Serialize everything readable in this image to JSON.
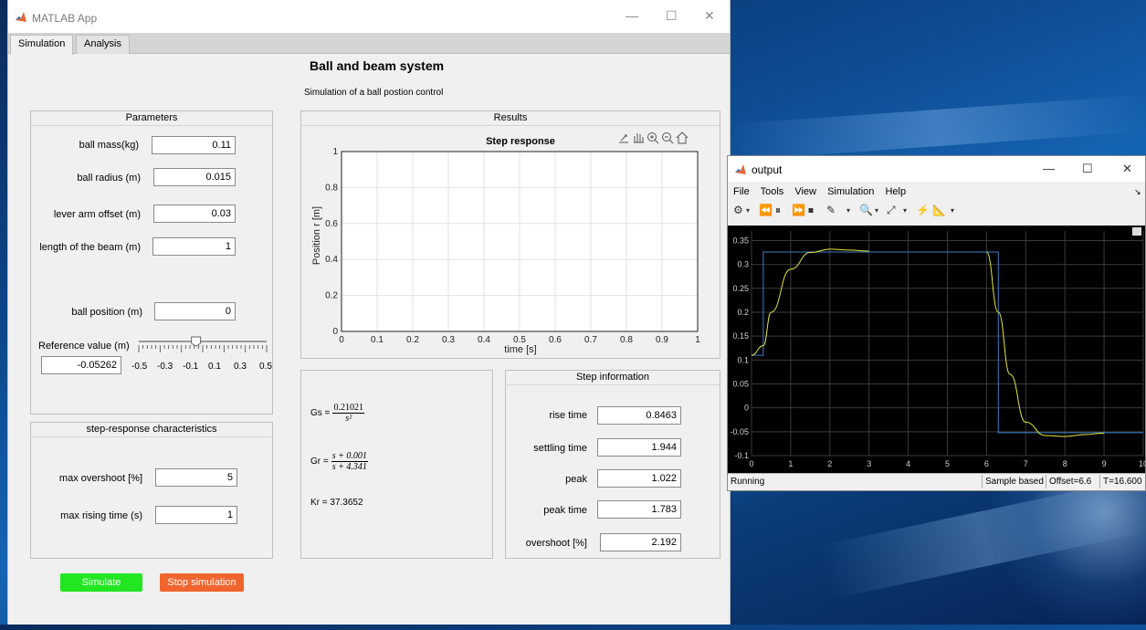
{
  "app": {
    "title": "MATLAB App",
    "tabs": [
      "Simulation",
      "Analysis"
    ],
    "heading": "Ball and beam system",
    "subheading": "Simulation of a ball postion control"
  },
  "parameters": {
    "title": "Parameters",
    "fields": [
      {
        "label": "ball mass(kg)",
        "value": "0.11"
      },
      {
        "label": "ball radius (m)",
        "value": "0.015"
      },
      {
        "label": "lever arm offset (m)",
        "value": "0.03"
      },
      {
        "label": "length of the beam (m)",
        "value": "1"
      },
      {
        "label": "ball position (m)",
        "value": "0"
      }
    ],
    "reference_label": "Reference value (m)",
    "reference_value": "-0.05262",
    "slider_ticks": [
      "-0.5",
      "-0.3",
      "-0.1",
      "0.1",
      "0.3",
      "0.5"
    ],
    "slider_value": -0.05262
  },
  "results": {
    "title": "Results",
    "plot_title": "Step response",
    "xlabel": "time [s]",
    "ylabel": "Position  r [m]",
    "xticks": [
      "0",
      "0.1",
      "0.2",
      "0.3",
      "0.4",
      "0.5",
      "0.6",
      "0.7",
      "0.8",
      "0.9",
      "1"
    ],
    "yticks": [
      "0",
      "0.2",
      "0.4",
      "0.6",
      "0.8",
      "1"
    ]
  },
  "transfer": {
    "gs_label": "Gs =",
    "gs_num": "0.21021",
    "gs_den": "s²",
    "gr_label": "Gr =",
    "gr_num": "s + 0.001",
    "gr_den": "s + 4.341",
    "kr": "Kr =   37.3652"
  },
  "step_characteristics": {
    "title": "step-response characteristics",
    "fields": [
      {
        "label": "max overshoot [%]",
        "value": "5"
      },
      {
        "label": "max rising time (s)",
        "value": "1"
      }
    ]
  },
  "step_info": {
    "title": "Step information",
    "fields": [
      {
        "label": "rise time",
        "value": "0.8463"
      },
      {
        "label": "settling time",
        "value": "1.944"
      },
      {
        "label": "peak",
        "value": "1.022"
      },
      {
        "label": "peak time",
        "value": "1.783"
      },
      {
        "label": "overshoot [%]",
        "value": "2.192"
      }
    ]
  },
  "buttons": {
    "simulate": "Simulate",
    "stop": "Stop simulation"
  },
  "colors": {
    "simulate": "#22e622",
    "stop": "#f0652e",
    "scope_bg": "#000000",
    "reference_line": "#3c7fc8",
    "response_line": "#e6e63c"
  },
  "output": {
    "title": "output",
    "menu": [
      "File",
      "Tools",
      "View",
      "Simulation",
      "Help"
    ],
    "status": "Running",
    "sample": "Sample based",
    "offset": "Offset=6.6",
    "time": "T=16.600",
    "yticks": [
      "0.35",
      "0.3",
      "0.25",
      "0.2",
      "0.15",
      "0.1",
      "0.05",
      "0",
      "-0.05",
      "-0.1"
    ],
    "xticks": [
      "0",
      "1",
      "2",
      "3",
      "4",
      "5",
      "6",
      "7",
      "8",
      "9",
      "10"
    ]
  },
  "chart_data": {
    "type": "line",
    "x": [
      0,
      0.3,
      0.5,
      1,
      1.5,
      2,
      2.5,
      3,
      3.5,
      4,
      4.5,
      5,
      5.5,
      6,
      6.3,
      6.6,
      7,
      7.5,
      8,
      8.5,
      9,
      9.5,
      10
    ],
    "series": [
      {
        "values": [
          0.11,
          0.326,
          0.326,
          0.326,
          0.326,
          0.326,
          0.326,
          0.326,
          0.326,
          0.326,
          0.326,
          0.326,
          0.326,
          0.326,
          -0.052,
          -0.052,
          -0.052,
          -0.052,
          -0.052,
          -0.052,
          -0.052,
          -0.052,
          -0.052
        ]
      },
      {
        "values": [
          0.11,
          0.13,
          0.2,
          0.29,
          0.325,
          0.332,
          0.33,
          0.328,
          null,
          null,
          null,
          null,
          null,
          0.326,
          0.2,
          0.07,
          -0.03,
          -0.058,
          -0.06,
          -0.056,
          -0.053,
          null,
          null
        ]
      }
    ],
    "xlim": [
      0,
      10
    ],
    "ylim": [
      -0.1,
      0.37
    ]
  }
}
